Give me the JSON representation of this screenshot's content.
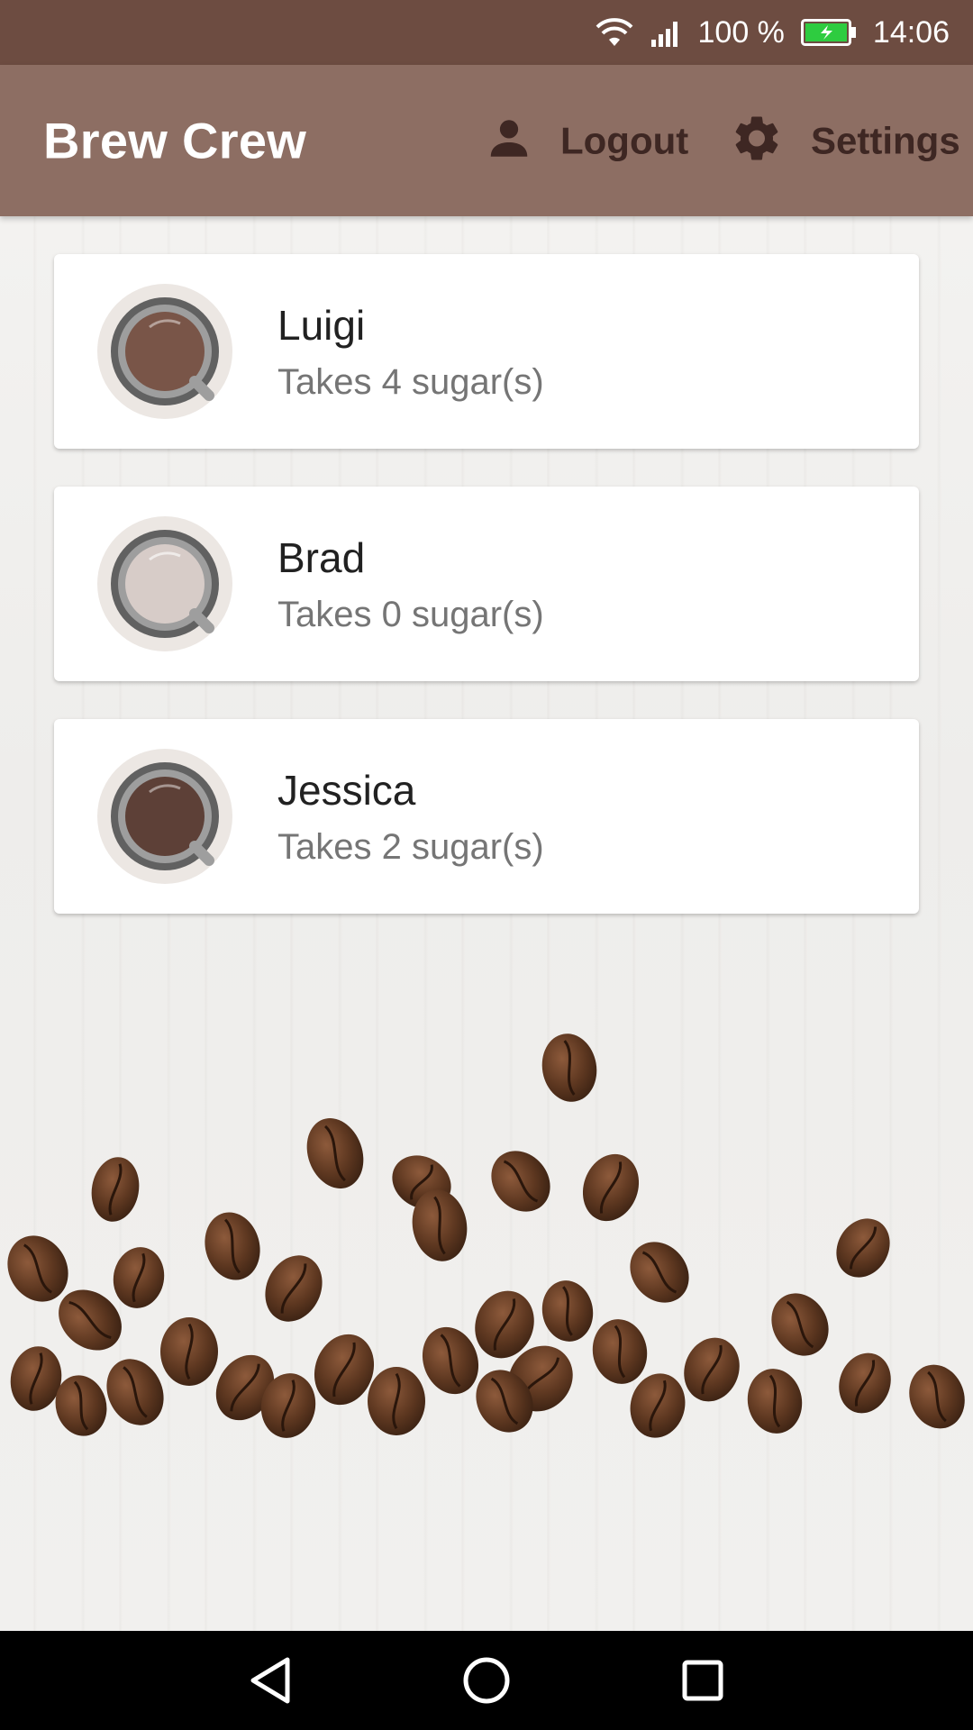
{
  "status_bar": {
    "battery_percent": "100 %",
    "time": "14:06",
    "icons": [
      "wifi-icon",
      "cell-signal-icon",
      "battery-charging-icon"
    ]
  },
  "app_bar": {
    "title": "Brew Crew",
    "logout_label": "Logout",
    "settings_label": "Settings",
    "icons": {
      "logout": "person-icon",
      "settings": "gear-icon"
    }
  },
  "brews": [
    {
      "name": "Luigi",
      "subtitle": "Takes 4 sugar(s)",
      "coffee_color": "#795548"
    },
    {
      "name": "Brad",
      "subtitle": "Takes 0 sugar(s)",
      "coffee_color": "#d7ccc8"
    },
    {
      "name": "Jessica",
      "subtitle": "Takes 2 sugar(s)",
      "coffee_color": "#5d4037"
    }
  ],
  "nav_bar": {
    "icons": [
      "back-icon",
      "home-icon",
      "recents-icon"
    ]
  },
  "colors": {
    "status_bar": "#6d4c41",
    "app_bar": "#8d6e63",
    "action_text": "#3e2723",
    "card": "#ffffff"
  }
}
